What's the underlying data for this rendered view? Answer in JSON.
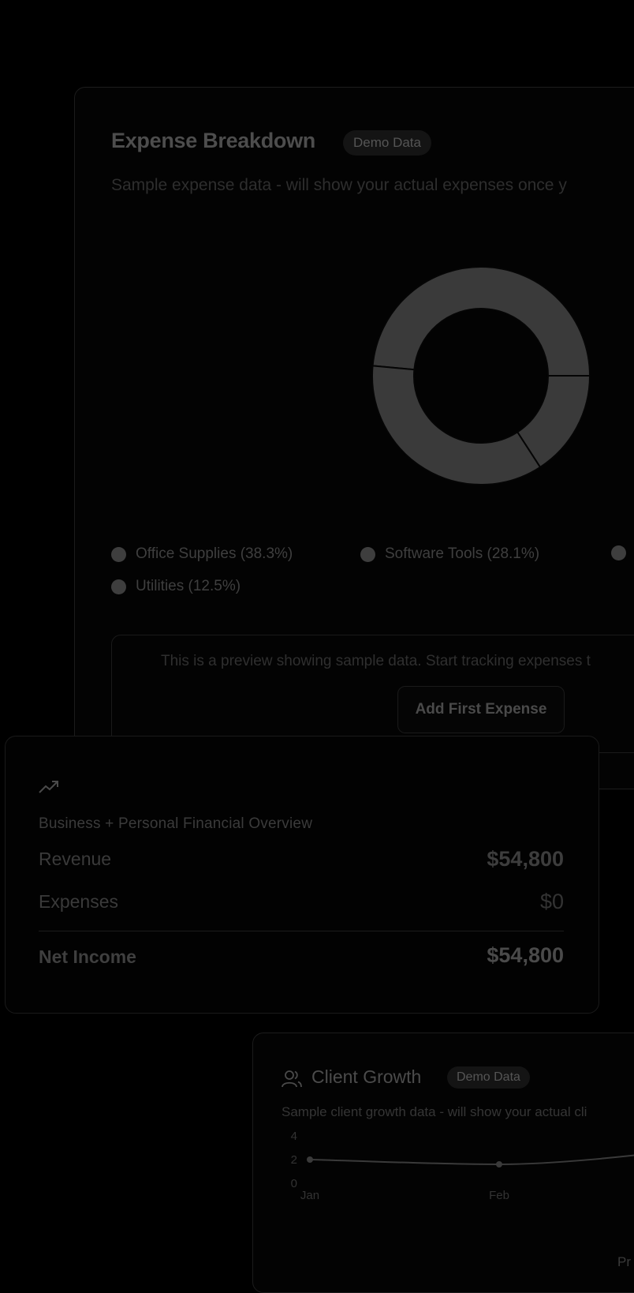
{
  "expense": {
    "title": "Expense Breakdown",
    "badge": "Demo Data",
    "subtitle": "Sample expense data - will show your actual expenses once y",
    "legend": [
      {
        "label": "Office Supplies (38.3%)",
        "color": "#3e3e3e"
      },
      {
        "label": "Software Tools (28.1%)",
        "color": "#3e3e3e"
      },
      {
        "label": "Utilities (12.5%)",
        "color": "#3e3e3e"
      }
    ],
    "preview_text": "This is a preview showing sample data. Start tracking expenses t",
    "add_button": "Add First Expense"
  },
  "chart_data": [
    {
      "type": "pie",
      "categories": [
        "Office Supplies",
        "Software Tools",
        "Utilities"
      ],
      "values": [
        38.3,
        28.1,
        12.5
      ]
    },
    {
      "type": "line",
      "categories": [
        "Jan",
        "Feb"
      ],
      "series": [
        {
          "values": [
            2,
            1.6
          ]
        }
      ],
      "ylim": [
        0,
        4
      ],
      "yticks": [
        "4",
        "2",
        "0"
      ]
    }
  ],
  "finance": {
    "icon": "trending-up-icon",
    "subtitle": "Business + Personal Financial Overview",
    "revenue_label": "Revenue",
    "revenue_value": "$54,800",
    "expenses_label": "Expenses",
    "expenses_value": "$0",
    "net_label": "Net Income",
    "net_value": "$54,800"
  },
  "client": {
    "icon": "users-icon",
    "title": "Client Growth",
    "badge": "Demo Data",
    "subtitle": "Sample client growth data - will show your actual cli",
    "partial_label": "Pr"
  }
}
